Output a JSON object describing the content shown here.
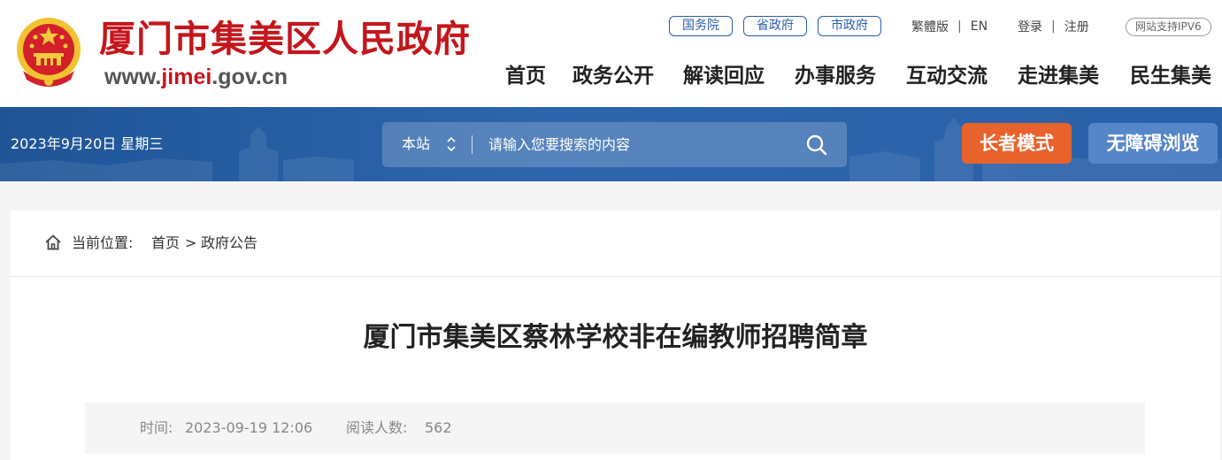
{
  "header": {
    "site_title": "厦门市集美区人民政府",
    "url_prefix": "www.",
    "url_highlight": "jimei",
    "url_suffix": ".gov.cn",
    "gov_links": [
      "国务院",
      "省政府",
      "市政府"
    ],
    "util": {
      "traditional": "繁體版",
      "english": "EN",
      "login": "登录",
      "register": "注册",
      "separator": "|"
    },
    "ipv6_badge": "网站支持IPV6",
    "nav": [
      "首页",
      "政务公开",
      "解读回应",
      "办事服务",
      "互动交流",
      "走进集美",
      "民生集美"
    ]
  },
  "banner": {
    "date": "2023年9月20日 星期三",
    "search_scope": "本站",
    "search_placeholder": "请输入您要搜索的内容",
    "elder_mode": "长者模式",
    "accessible": "无障碍浏览"
  },
  "breadcrumb": {
    "label": "当前位置:",
    "home": "首页",
    "separator": ">",
    "current": "政府公告"
  },
  "article": {
    "title": "厦门市集美区蔡林学校非在编教师招聘简章",
    "time_label": "时间:",
    "time_value": "2023-09-19 12:06",
    "views_label": "阅读人数:",
    "views_value": "562"
  },
  "colors": {
    "brand_red": "#c4161c",
    "banner_blue": "#2a60a7",
    "elder_orange": "#e8622c",
    "access_blue": "#5586c9",
    "link_blue": "#2a5ea8"
  },
  "icons": [
    "national-emblem-icon",
    "scope-arrows-icon",
    "search-icon",
    "home-icon"
  ]
}
